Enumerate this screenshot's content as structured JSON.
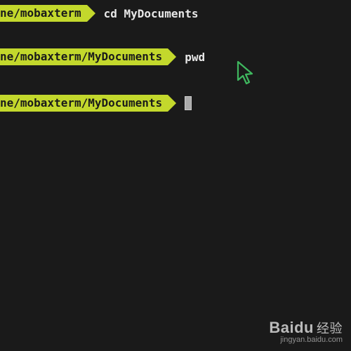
{
  "lines": [
    {
      "path": "ne/mobaxterm",
      "command": "cd MyDocuments"
    },
    {
      "path": "ne/mobaxterm/MyDocuments",
      "command": "pwd"
    },
    {
      "path": "ne/mobaxterm/MyDocuments",
      "command": ""
    }
  ],
  "watermark": {
    "brand": "Baidu",
    "brand_cn": "经验",
    "url": "jingyan.baidu.com"
  },
  "colors": {
    "background": "#1a1a1a",
    "prompt_bg": "#c3d82c",
    "text": "#e8e8e8",
    "cursor_arrow": "#2fa84f"
  }
}
